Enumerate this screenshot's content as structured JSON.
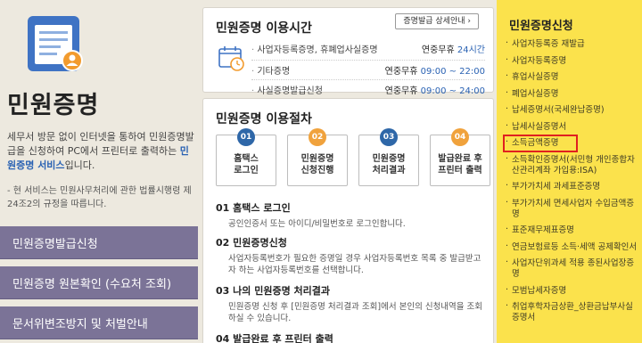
{
  "left": {
    "title": "민원증명",
    "intro_before": "세무서 방문 없이 인터넷을 통하여 민원증명발급을 신청하여 PC에서 프린터로 출력하는",
    "intro_link": "민원증명 서비스",
    "intro_after": "입니다.",
    "note": "- 현 서비스는 민원사무처리에 관한 법률시행령 제24조2의 규정을 따릅니다.",
    "buttons": [
      "민원증명발급신청",
      "민원증명 원본확인 (수요처 조회)",
      "문서위변조방지 및 처벌안내"
    ]
  },
  "hours": {
    "title": "민원증명 이용시간",
    "detail_button": "증명발급 상세안내",
    "rows": [
      {
        "label": "사업자등록증명, 휴폐업사실증명",
        "value_prefix": "연중무휴 ",
        "value_highlight": "24시간"
      },
      {
        "label": "기타증명",
        "value_prefix": "연중무휴 ",
        "value_highlight": "09:00 ~ 22:00"
      },
      {
        "label": "사실증명발급신청",
        "value_prefix": "연중무휴 ",
        "value_highlight": "09:00 ~ 24:00"
      }
    ]
  },
  "procedure": {
    "title": "민원증명 이용절차",
    "steps": [
      {
        "num": "01",
        "text": "홈택스\n로그인"
      },
      {
        "num": "02",
        "text": "민원증명\n신청진행"
      },
      {
        "num": "03",
        "text": "민원증명\n처리결과"
      },
      {
        "num": "04",
        "text": "발급완료 후\n프린터 출력"
      }
    ],
    "items": [
      {
        "heading": "01 홈택스 로그인",
        "desc": "공인인증서 또는 아이디/비밀번호로 로그인합니다."
      },
      {
        "heading": "02 민원증명신청",
        "desc": "사업자등록번호가 필요한 증명일 경우 사업자등록번호 목록 중 발급받고자 하는 사업자등록번호를 선택합니다."
      },
      {
        "heading": "03 나의 민원증명 처리결과",
        "desc": "민원증명 신청 후 [민원증명 처리결과 조회]에서 본인의 신청내역을 조회 하실 수 있습니다."
      },
      {
        "heading": "04 발급완료 후 프린터 출력",
        "desc": ""
      }
    ]
  },
  "right": {
    "title": "민원증명신청",
    "items": [
      "사업자등록증 재발급",
      "사업자등록증명",
      "휴업사실증명",
      "폐업사실증명",
      "납세증명서(국세완납증명)",
      "납세사실증명서",
      "소득금액증명",
      "소득확인증명서(서민형 개인종합자산관리계좌 가입용:ISA)",
      "부가가치세 과세표준증명",
      "부가가치세 면세사업자 수입금액증명",
      "표준재무제표증명",
      "연금보험료등 소득·세액 공제확인서",
      "사업자단위과세 적용 종된사업장증명",
      "모범납세자증명",
      "취업후학자금상환_상환금납부사실증명서"
    ],
    "active_index": 6,
    "highlight_color": "#e02020",
    "background_color": "#fbe24c"
  }
}
